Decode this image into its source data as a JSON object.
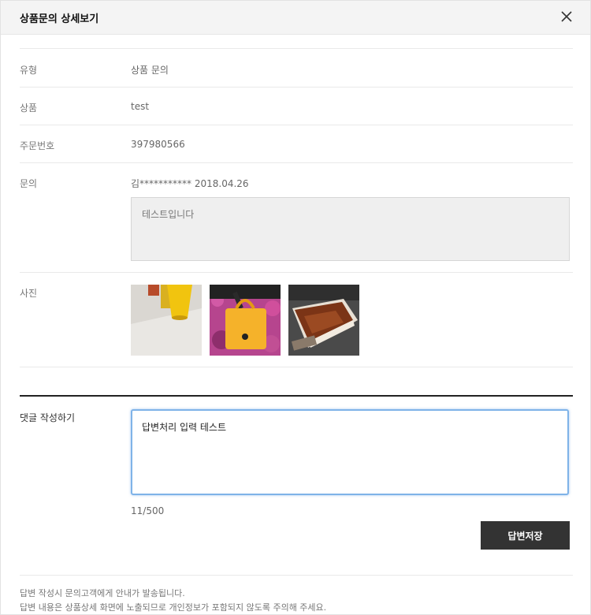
{
  "header": {
    "title": "상품문의 상세보기"
  },
  "fields": {
    "type": {
      "label": "유형",
      "value": "상품 문의"
    },
    "product": {
      "label": "상품",
      "value": "test"
    },
    "order_number": {
      "label": "주문번호",
      "value": "397980566"
    },
    "inquiry": {
      "label": "문의",
      "author_date": "김*********** 2018.04.26",
      "body": "테스트입니다"
    },
    "photos": {
      "label": "사진"
    }
  },
  "reply": {
    "label": "댓글 작성하기",
    "value": "답변처리 입력 테스트",
    "char_count": "11/500",
    "save_label": "답변저장"
  },
  "notice": {
    "line1": "답변 작성시 문의고객에게 안내가 발송됩니다.",
    "line2": "답변 내용은 상품상세 화면에 노출되므로 개인정보가 포함되지 않도록 주의해 주세요."
  },
  "colors": {
    "header_bg": "#f4f4f4",
    "button_bg": "#333333",
    "focus_border": "#7fb3e8"
  },
  "icons": {
    "close": "close-icon"
  }
}
